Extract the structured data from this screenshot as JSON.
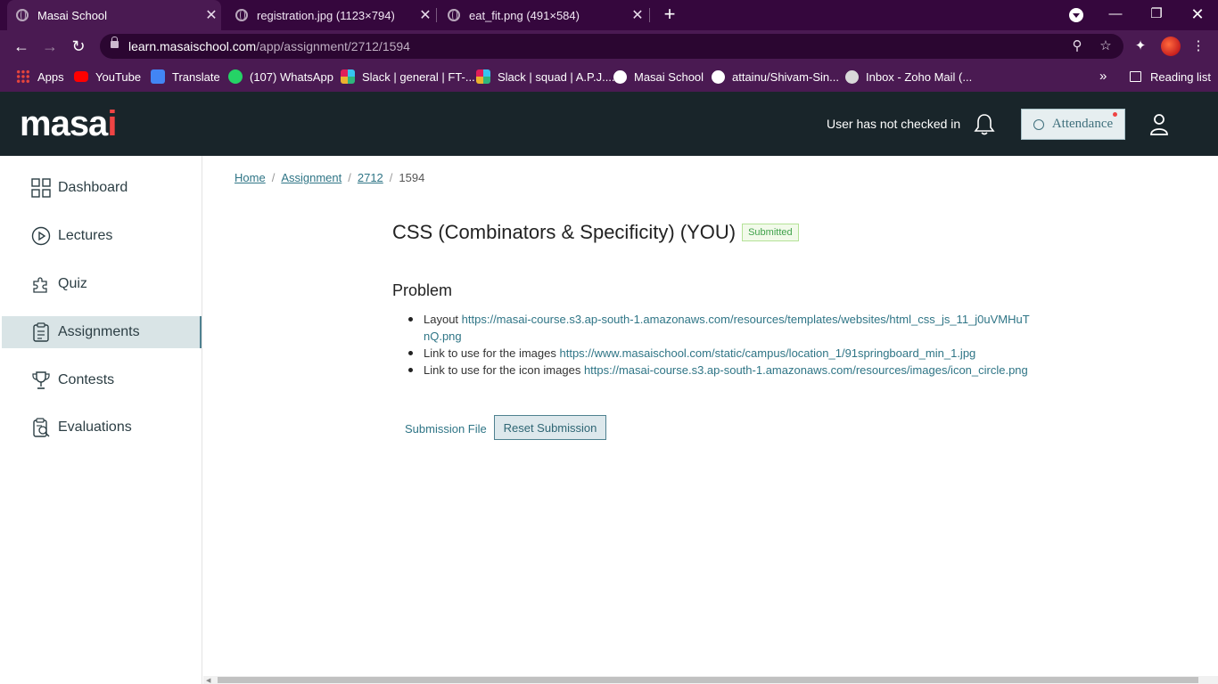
{
  "browser": {
    "tabs": [
      {
        "title": "Masai School",
        "active": true
      },
      {
        "title": "registration.jpg (1123×794)",
        "active": false
      },
      {
        "title": "eat_fit.png (491×584)",
        "active": false
      }
    ],
    "new_tab_symbol": "+",
    "url_host": "learn.masaischool.com",
    "url_path": "/app/assignment/2712/1594",
    "bookmarks": [
      {
        "label": "Apps",
        "icon": "apps-grid-icon",
        "color": "#e8453c"
      },
      {
        "label": "YouTube",
        "icon": "youtube-icon",
        "color": "#ff0000"
      },
      {
        "label": "Translate",
        "icon": "translate-icon",
        "color": "#4285f4"
      },
      {
        "label": "(107) WhatsApp",
        "icon": "whatsapp-icon",
        "color": "#25d366"
      },
      {
        "label": "Slack | general | FT-...",
        "icon": "slack-icon",
        "color": "#e01e5a"
      },
      {
        "label": "Slack | squad | A.P.J....",
        "icon": "slack-icon",
        "color": "#e01e5a"
      },
      {
        "label": "Masai School",
        "icon": "globe-icon",
        "color": "#ffffff"
      },
      {
        "label": "attainu/Shivam-Sin...",
        "icon": "github-icon",
        "color": "#ffffff"
      },
      {
        "label": "Inbox - Zoho Mail (...",
        "icon": "zoho-mail-icon",
        "color": "#d9d9d9"
      }
    ],
    "bookmarks_more": "»",
    "reading_list": "Reading list"
  },
  "header": {
    "logo_main": "masa",
    "logo_accent": "i",
    "checkin_status": "User has not checked in",
    "attendance_label": "Attendance"
  },
  "sidebar": {
    "items": [
      {
        "label": "Dashboard",
        "icon": "dashboard-icon"
      },
      {
        "label": "Lectures",
        "icon": "play-circle-icon"
      },
      {
        "label": "Quiz",
        "icon": "puzzle-icon"
      },
      {
        "label": "Assignments",
        "icon": "clipboard-icon",
        "active": true
      },
      {
        "label": "Contests",
        "icon": "trophy-icon"
      },
      {
        "label": "Evaluations",
        "icon": "evaluation-icon"
      }
    ]
  },
  "breadcrumb": {
    "home": "Home",
    "assignment": "Assignment",
    "id1": "2712",
    "id2": "1594",
    "sep": "/"
  },
  "assignment": {
    "title": "CSS (Combinators & Specificity) (YOU)",
    "status": "Submitted",
    "problem_heading": "Problem",
    "items": [
      {
        "text": "Layout ",
        "link": "https://masai-course.s3.ap-south-1.amazonaws.com/resources/templates/websites/html_css_js_11_j0uVMHuTnQ.png"
      },
      {
        "text": "Link to use for the images ",
        "link": "https://www.masaischool.com/static/campus/location_1/91springboard_min_1.jpg"
      },
      {
        "text": "Link to use for the icon images ",
        "link": "https://masai-course.s3.ap-south-1.amazonaws.com/resources/images/icon_circle.png"
      }
    ],
    "submission_file": "Submission File",
    "reset_button": "Reset Submission"
  },
  "colors": {
    "browser_frame": "#35073d",
    "app_header": "#19252a",
    "accent": "#2f7586",
    "logo_dot": "#ef4444",
    "badge_green": "#3fa14a"
  }
}
